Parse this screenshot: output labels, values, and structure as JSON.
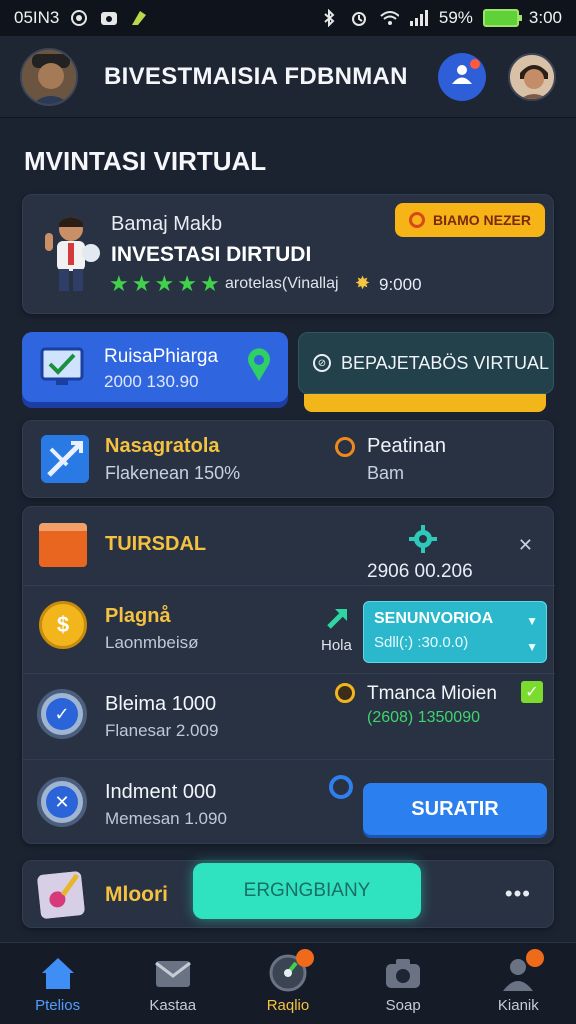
{
  "status_bar": {
    "left_text": "05IN3",
    "battery_text": "59%",
    "time": "3:00"
  },
  "header": {
    "title": "BIVESTMAISIA FDBNMAN"
  },
  "page_title": "MVINTASI VIRTUAL",
  "profile": {
    "name": "Bamaj Makb",
    "subtitle": "INVESTASI DIRTUDI",
    "rating_stars": 5,
    "meta": "arotelas(Vinallaj",
    "amount": "9:000",
    "badge": "BIAMO NEZER"
  },
  "tile_blue": {
    "title": "RuisaPhiarga",
    "value": "2000 130.90"
  },
  "tile_teal": {
    "label": "BEPAJETABÖS VIRTUAL"
  },
  "stats": {
    "left_title": "Nasagratola",
    "left_sub": "Flakenean 150%",
    "right_title": "Peatinan",
    "right_sub": "Bam"
  },
  "list": {
    "row1": {
      "title": "TUIRSDAL",
      "value": "2906 00.206"
    },
    "row2": {
      "title": "Plagnå",
      "sub": "Laonmbeisø",
      "hint": "Hola",
      "box_title": "SENUNVORIOA",
      "box_value": "Sdll(:) :30.0.0)"
    },
    "row3": {
      "title": "Bleima 1000",
      "sub": "Flanesar 2.009",
      "right_title": "Tmanca Mioien",
      "right_value": "(2608) 1350090"
    },
    "row4": {
      "title": "Indment 000",
      "sub": "Memesan 1.090",
      "button": "SURATIR"
    }
  },
  "bottom": {
    "title": "Mloori",
    "button": "ERGNGBIANY",
    "more": "•••"
  },
  "nav": [
    {
      "label": "Ptelios"
    },
    {
      "label": "Kastaa"
    },
    {
      "label": "Raqlio"
    },
    {
      "label": "Soap"
    },
    {
      "label": "Kianik"
    }
  ]
}
